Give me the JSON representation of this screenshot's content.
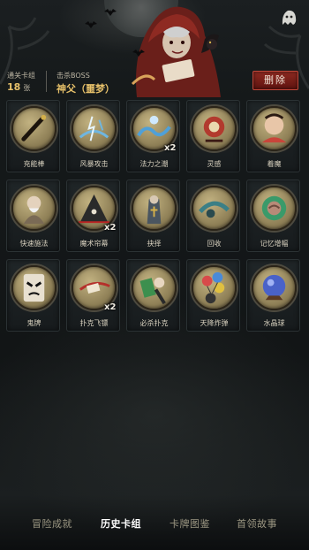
{
  "header": {
    "cleared_label": "通关卡组",
    "cleared_value": "18",
    "cleared_unit": "张",
    "boss_label": "击杀BOSS",
    "boss_value": "神父（噩梦）",
    "delete_label": "删除"
  },
  "cards": [
    {
      "label": "充能棒",
      "count": "",
      "icon": "wand-icon",
      "color": "#3b2f1e"
    },
    {
      "label": "风暴攻击",
      "count": "",
      "icon": "storm-icon",
      "color": "#6fb6e0"
    },
    {
      "label": "法力之潮",
      "count": "x2",
      "icon": "mana-tide-icon",
      "color": "#4fa0d8"
    },
    {
      "label": "灵感",
      "count": "",
      "icon": "inspiration-icon",
      "color": "#b23a2e"
    },
    {
      "label": "着魔",
      "count": "",
      "icon": "possessed-icon",
      "color": "#c9453a"
    },
    {
      "label": "快速施法",
      "count": "",
      "icon": "wizard-icon",
      "color": "#7a6a55"
    },
    {
      "label": "魔术帘幕",
      "count": "x2",
      "icon": "magic-curtain-icon",
      "color": "#2a2a2a"
    },
    {
      "label": "抉择",
      "count": "",
      "icon": "priest-icon",
      "color": "#4a5560"
    },
    {
      "label": "回收",
      "count": "",
      "icon": "recycle-icon",
      "color": "#3b7f86"
    },
    {
      "label": "记忆增幅",
      "count": "",
      "icon": "brain-icon",
      "color": "#3a9a6a"
    },
    {
      "label": "鬼牌",
      "count": "",
      "icon": "joker-icon",
      "color": "#e8e0d0"
    },
    {
      "label": "扑克飞镖",
      "count": "x2",
      "icon": "card-dart-icon",
      "color": "#b5302b"
    },
    {
      "label": "必杀扑克",
      "count": "",
      "icon": "killer-card-icon",
      "color": "#3c8f4e"
    },
    {
      "label": "天降炸弹",
      "count": "",
      "icon": "balloon-bomb-icon",
      "color": "#d84a4a"
    },
    {
      "label": "水晶球",
      "count": "",
      "icon": "crystal-ball-icon",
      "color": "#4a62c8"
    }
  ],
  "tabs": [
    {
      "label": "冒险成就",
      "active": false
    },
    {
      "label": "历史卡组",
      "active": true
    },
    {
      "label": "卡牌图鉴",
      "active": false
    },
    {
      "label": "首领故事",
      "active": false
    }
  ]
}
